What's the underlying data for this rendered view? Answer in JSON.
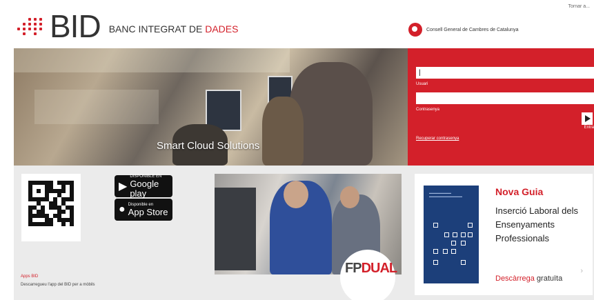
{
  "header": {
    "topright_link": "Tornar a...",
    "logo_text": "BID",
    "org_name_prefix": "BANC INTEGRAT DE ",
    "org_name_highlight": "DADES",
    "partner_name": "Consell General de Cambres de Catalunya"
  },
  "hero": {
    "caption": "Smart Cloud Solutions"
  },
  "login": {
    "user_value": "|",
    "user_label": "Usuari",
    "password_label": "Contrasenya",
    "forgot_link": "Recuperar contrasenya",
    "submit_label": "Entra"
  },
  "apps": {
    "google_small": "DISPONIBLE EN",
    "google_big": "Google play",
    "apple_small": "Disponible en",
    "apple_big": "App Store",
    "title": "Apps BID",
    "text": "Descarregueu l'app del BID per a mòbils"
  },
  "fp": {
    "prefix": "FP",
    "highlight": "DUAL"
  },
  "guide": {
    "label": "Nova Guia",
    "title": "Inserció Laboral dels Ensenyaments Professionals",
    "link_highlight": "Descàrrega",
    "link_rest": " gratuïta",
    "arrow": "›"
  }
}
